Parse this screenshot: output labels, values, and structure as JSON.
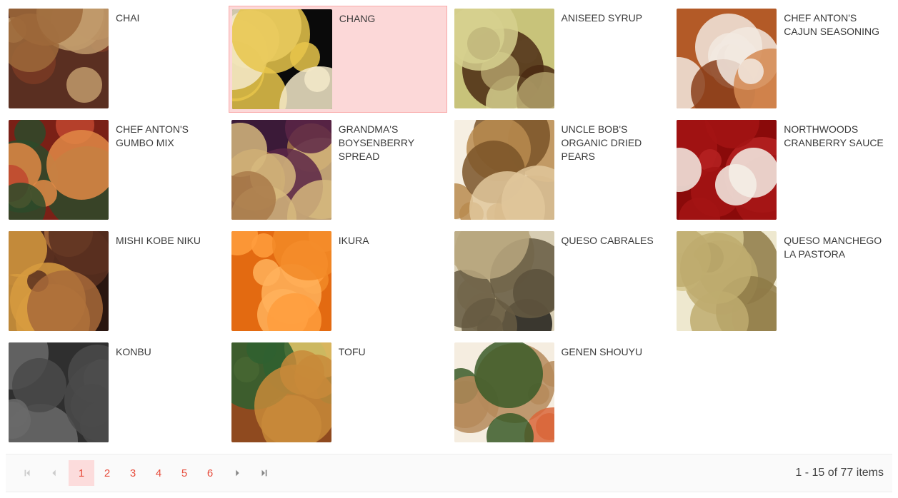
{
  "items": [
    {
      "name": "Chai",
      "selected": false,
      "palette": [
        "#5a2f21",
        "#7a3a23",
        "#c19a6b",
        "#9d693a"
      ]
    },
    {
      "name": "Chang",
      "selected": true,
      "palette": [
        "#0a0a0a",
        "#2a2a10",
        "#e7c64b",
        "#f3e9c9"
      ]
    },
    {
      "name": "Aniseed Syrup",
      "selected": false,
      "palette": [
        "#c8c37a",
        "#d6d08e",
        "#4a2a12",
        "#b09f68"
      ]
    },
    {
      "name": "Chef Anton's Cajun Seasoning",
      "selected": false,
      "palette": [
        "#b35a27",
        "#d58a52",
        "#f2e9e1",
        "#8a3e1b"
      ]
    },
    {
      "name": "Chef Anton's Gumbo Mix",
      "selected": false,
      "palette": [
        "#7a2016",
        "#c0472f",
        "#e28a47",
        "#2d4a2a"
      ]
    },
    {
      "name": "Grandma's Boysenberry Spread",
      "selected": false,
      "palette": [
        "#3b1a38",
        "#5c2647",
        "#a97a4a",
        "#d6b97e"
      ]
    },
    {
      "name": "Uncle Bob's Organic Dried Pears",
      "selected": false,
      "palette": [
        "#f6efe2",
        "#e0c79b",
        "#b88b4f",
        "#7a5428"
      ]
    },
    {
      "name": "Northwoods Cranberry Sauce",
      "selected": false,
      "palette": [
        "#8a0a0a",
        "#a31414",
        "#b52222",
        "#f5f0e8"
      ]
    },
    {
      "name": "Mishi Kobe Niku",
      "selected": false,
      "palette": [
        "#2a1610",
        "#5b3020",
        "#d79b3f",
        "#a86a39"
      ]
    },
    {
      "name": "Ikura",
      "selected": false,
      "palette": [
        "#e36a11",
        "#f28a27",
        "#ff9d3d",
        "#ffb25c"
      ]
    },
    {
      "name": "Queso Cabrales",
      "selected": false,
      "palette": [
        "#d7cdb3",
        "#665a42",
        "#1e1c18",
        "#b9a77f"
      ]
    },
    {
      "name": "Queso Manchego La Pastora",
      "selected": false,
      "palette": [
        "#eee8cf",
        "#d6c890",
        "#beab6e",
        "#8e7a46"
      ]
    },
    {
      "name": "Konbu",
      "selected": false,
      "palette": [
        "#2f2f2f",
        "#4a4a4a",
        "#6a6a6a",
        "#c9c9c9"
      ]
    },
    {
      "name": "Tofu",
      "selected": false,
      "palette": [
        "#8f4a1f",
        "#c88a3a",
        "#e5c86a",
        "#2f6030"
      ]
    },
    {
      "name": "Genen Shouyu",
      "selected": false,
      "palette": [
        "#f5ede0",
        "#d9663a",
        "#3a5a28",
        "#b58a5a"
      ]
    }
  ],
  "pager": {
    "pages": [
      "1",
      "2",
      "3",
      "4",
      "5",
      "6"
    ],
    "current": 1,
    "status": "1 - 15 of 77 items"
  }
}
